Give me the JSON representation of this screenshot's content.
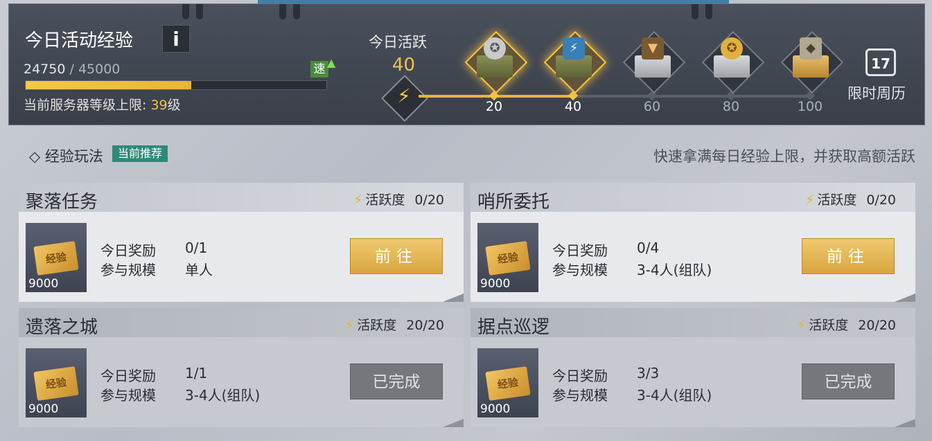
{
  "header": {
    "title": "今日活动经验",
    "info_label": "i",
    "exp_current": "24750",
    "exp_separator": " / ",
    "exp_max": "45000",
    "exp_progress": 0.55,
    "speed_badge": "速",
    "server_cap_label": "当前服务器等级上限: ",
    "server_cap_level": "39",
    "server_cap_unit": "级"
  },
  "activity": {
    "label": "今日活跃",
    "value": "40",
    "milestones": [
      {
        "value": "20",
        "reached": true
      },
      {
        "value": "40",
        "reached": true
      },
      {
        "value": "60",
        "reached": false
      },
      {
        "value": "80",
        "reached": false
      },
      {
        "value": "100",
        "reached": false
      }
    ],
    "calendar_day": "17",
    "calendar_label": "限时周历"
  },
  "section": {
    "title": "经验玩法",
    "badge": "当前推荐",
    "hint": "快速拿满每日经验上限，并获取高额活跃"
  },
  "labels": {
    "activity": "活跃度",
    "reward_today": "今日奖励",
    "scale": "参与规模",
    "go": "前往",
    "completed": "已完成"
  },
  "cards": [
    {
      "title": "聚落任务",
      "activity": "0/20",
      "reward": "0/1",
      "scale": "单人",
      "exp": "9000",
      "ticket": "经验",
      "done": false
    },
    {
      "title": "哨所委托",
      "activity": "0/20",
      "reward": "0/4",
      "scale": "3-4人(组队)",
      "exp": "9000",
      "ticket": "经验",
      "done": false
    },
    {
      "title": "遗落之城",
      "activity": "20/20",
      "reward": "1/1",
      "scale": "3-4人(组队)",
      "exp": "9000",
      "ticket": "经验",
      "done": true
    },
    {
      "title": "据点巡逻",
      "activity": "20/20",
      "reward": "3/3",
      "scale": "3-4人(组队)",
      "exp": "9000",
      "ticket": "经验",
      "done": true
    }
  ]
}
